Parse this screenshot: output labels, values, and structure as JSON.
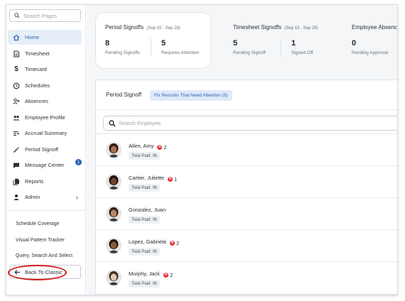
{
  "sidebar": {
    "search_placeholder": "Search Pages",
    "items": [
      {
        "label": "Home",
        "icon": "home-icon",
        "active": true
      },
      {
        "label": "Timesheet",
        "icon": "document-icon"
      },
      {
        "label": "Timecard",
        "icon": "dollar-icon"
      },
      {
        "label": "Schedules",
        "icon": "clock-icon"
      },
      {
        "label": "Absences",
        "icon": "person-x-icon"
      },
      {
        "label": "Employee Profile",
        "icon": "people-icon"
      },
      {
        "label": "Accrual Summary",
        "icon": "list-sum-icon"
      },
      {
        "label": "Period Signoff",
        "icon": "wand-icon"
      },
      {
        "label": "Message Center",
        "icon": "message-icon",
        "badge": "1"
      },
      {
        "label": "Reports",
        "icon": "reports-icon"
      },
      {
        "label": "Admin",
        "icon": "person-icon",
        "chevron": "›"
      }
    ],
    "links": [
      "Schedule Coverage",
      "Visual Pattern Tracker",
      "Query, Search And Select"
    ],
    "back_label": "Back To Classic"
  },
  "stats": {
    "period": {
      "title": "Period Signoffs",
      "range": "(Sep 15 - Sep 28)",
      "a_num": "8",
      "a_label": "Pending Signoffs",
      "b_num": "5",
      "b_label": "Requires Attention"
    },
    "timesheet": {
      "title": "Timesheet Signoffs",
      "range": "(Sep 15 - Sep 28)",
      "a_num": "5",
      "a_label": "Pending Signoff",
      "b_num": "1",
      "b_label": "Signed Off"
    },
    "absence": {
      "title": "Employee Absence",
      "a_num": "0",
      "a_label": "Pending Approval"
    }
  },
  "panel": {
    "title": "Period Signoff",
    "fix_label": "Fix Records That Need Attention (5)",
    "search_placeholder": "Search Employee"
  },
  "employees": [
    {
      "name": "Allen, Amy",
      "errors": "2",
      "paid": "Total Paid: 0h",
      "skin": "#a86f4e",
      "hair": "#2a1a12"
    },
    {
      "name": "Cartier, Juliette",
      "errors": "1",
      "paid": "Total Paid: 0h",
      "skin": "#6e4530",
      "hair": "#1e120c"
    },
    {
      "name": "Gonzalez, Juan",
      "errors": "",
      "paid": "Total Paid: 0h",
      "skin": "#b98566",
      "hair": "#2d2016"
    },
    {
      "name": "Lopez, Gabriela",
      "errors": "2",
      "paid": "Total Paid: 0h",
      "skin": "#8a5a40",
      "hair": "#23150e"
    },
    {
      "name": "Murphy, Jack",
      "errors": "2",
      "paid": "Total Paid: 0h",
      "skin": "#e3c7ae",
      "hair": "#3a3028"
    }
  ],
  "colors": {
    "accent": "#2a63b7",
    "error": "#e0353b",
    "annotation": "#d11a1a"
  }
}
